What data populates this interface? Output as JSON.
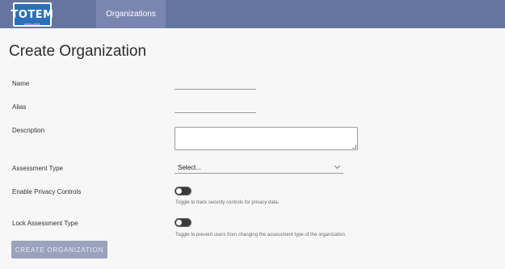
{
  "header": {
    "logo_text": "TOTEM",
    "logo_subtext": "600x600",
    "nav_tab": "Organizations"
  },
  "page": {
    "title": "Create Organization"
  },
  "form": {
    "name_label": "Name",
    "name_value": "",
    "alias_label": "Alias",
    "alias_value": "",
    "description_label": "Description",
    "description_value": "",
    "assessment_type_label": "Assessment Type",
    "assessment_type_selected": "Select...",
    "privacy_label": "Enable Privacy Controls",
    "privacy_enabled": false,
    "privacy_helper": "Toggle to track security controls for privacy data.",
    "lock_label": "Lock Assessment Type",
    "lock_enabled": false,
    "lock_helper": "Toggle to prevent users from changing the assessment type of the organization.",
    "submit_label": "CREATE ORGANIZATION"
  },
  "colors": {
    "header_bg": "#6674a1",
    "active_tab_bg": "#7a86af",
    "button_bg": "#9aa3bb"
  }
}
